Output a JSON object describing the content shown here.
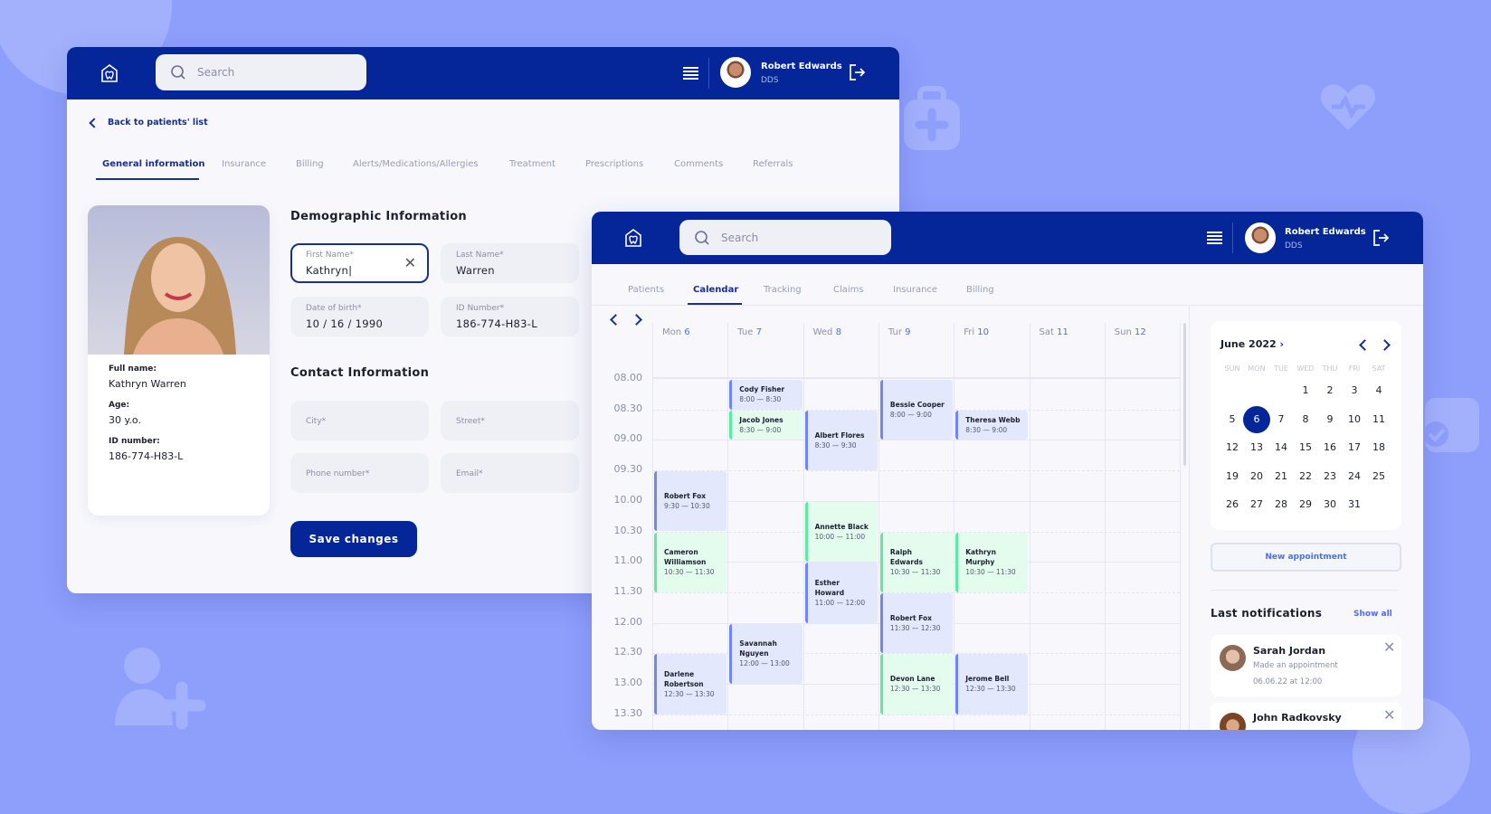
{
  "colors": {
    "background": "#8e9efb",
    "header": "#042698",
    "accent": "#4e6ef2",
    "event_blue": "#e3e8fc",
    "event_green": "#e3fcee"
  },
  "patient_window": {
    "search_placeholder": "Search",
    "user": {
      "name": "Robert Edwards",
      "role": "DDS"
    },
    "back_link": "Back to patients' list",
    "tabs": [
      {
        "label": "General information",
        "active": true
      },
      {
        "label": "Insurance"
      },
      {
        "label": "Billing"
      },
      {
        "label": "Alerts/Medications/Allergies"
      },
      {
        "label": "Treatment"
      },
      {
        "label": "Prescriptions"
      },
      {
        "label": "Comments"
      },
      {
        "label": "Referrals"
      }
    ],
    "profile": {
      "full_name_label": "Full name:",
      "full_name": "Kathryn Warren",
      "age_label": "Age:",
      "age": "30 y.o.",
      "id_label": "ID number:",
      "id": "186-774-H83-L"
    },
    "demographic": {
      "title": "Demographic Information",
      "first_name": {
        "label": "First Name*",
        "value": "Kathryn|"
      },
      "last_name": {
        "label": "Last Name*",
        "value": "Warren"
      },
      "dob": {
        "label": "Date of birth*",
        "value": "10 / 16 / 1990"
      },
      "id_number": {
        "label": "ID Number*",
        "value": "186-774-H83-L"
      }
    },
    "contact": {
      "title": "Contact Information",
      "city": "City*",
      "street": "Street*",
      "phone": "Phone number*",
      "email": "Email*"
    },
    "save_label": "Save changes"
  },
  "calendar_window": {
    "search_placeholder": "Search",
    "user": {
      "name": "Robert Edwards",
      "role": "DDS"
    },
    "tabs": [
      {
        "label": "Patients"
      },
      {
        "label": "Calendar",
        "active": true
      },
      {
        "label": "Tracking"
      },
      {
        "label": "Claims"
      },
      {
        "label": "Insurance"
      },
      {
        "label": "Billing"
      }
    ],
    "days": [
      {
        "name": "Mon",
        "num": "6"
      },
      {
        "name": "Tue",
        "num": "7"
      },
      {
        "name": "Wed",
        "num": "8"
      },
      {
        "name": "Tur",
        "num": "9"
      },
      {
        "name": "Fri",
        "num": "10"
      },
      {
        "name": "Sat",
        "num": "11"
      },
      {
        "name": "Sun",
        "num": "12"
      }
    ],
    "times": [
      "08.00",
      "08.30",
      "09.00",
      "09.30",
      "10.00",
      "10.30",
      "11.00",
      "11.30",
      "12.00",
      "12.30",
      "13.00",
      "13.30"
    ],
    "events": [
      {
        "day": 0,
        "name": "Robert Fox",
        "time": "9:30 — 10:30",
        "start": 9.5,
        "end": 10.5,
        "color": "blue"
      },
      {
        "day": 0,
        "name": "Cameron Williamson",
        "time": "10:30 — 11:30",
        "start": 10.5,
        "end": 11.5,
        "color": "green"
      },
      {
        "day": 0,
        "name": "Darlene Robertson",
        "time": "12:30 — 13:30",
        "start": 12.5,
        "end": 13.5,
        "color": "blue"
      },
      {
        "day": 1,
        "name": "Cody Fisher",
        "time": "8:00 — 8:30",
        "start": 8,
        "end": 8.5,
        "color": "blue"
      },
      {
        "day": 1,
        "name": "Jacob Jones",
        "time": "8:30 — 9:00",
        "start": 8.5,
        "end": 9,
        "color": "green"
      },
      {
        "day": 1,
        "name": "Savannah Nguyen",
        "time": "12:00 — 13:00",
        "start": 12,
        "end": 13,
        "color": "blue"
      },
      {
        "day": 2,
        "name": "Albert Flores",
        "time": "8:30 — 9:30",
        "start": 8.5,
        "end": 9.5,
        "color": "blue"
      },
      {
        "day": 2,
        "name": "Annette Black",
        "time": "10:00 — 11:00",
        "start": 10,
        "end": 11,
        "color": "green"
      },
      {
        "day": 2,
        "name": "Esther Howard",
        "time": "11:00 — 12:00",
        "start": 11,
        "end": 12,
        "color": "blue"
      },
      {
        "day": 3,
        "name": "Bessie Cooper",
        "time": "8:00 — 9:00",
        "start": 8,
        "end": 9,
        "color": "blue"
      },
      {
        "day": 3,
        "name": "Ralph Edwards",
        "time": "10:30 — 11:30",
        "start": 10.5,
        "end": 11.5,
        "color": "green"
      },
      {
        "day": 3,
        "name": "Robert Fox",
        "time": "11:30 — 12:30",
        "start": 11.5,
        "end": 12.5,
        "color": "blue"
      },
      {
        "day": 3,
        "name": "Devon Lane",
        "time": "12:30 — 13:30",
        "start": 12.5,
        "end": 13.5,
        "color": "green"
      },
      {
        "day": 4,
        "name": "Theresa Webb",
        "time": "8:30 — 9:00",
        "start": 8.5,
        "end": 9,
        "color": "blue"
      },
      {
        "day": 4,
        "name": "Kathryn Murphy",
        "time": "10:30 — 11:30",
        "start": 10.5,
        "end": 11.5,
        "color": "green"
      },
      {
        "day": 4,
        "name": "Jerome Bell",
        "time": "12:30 — 13:30",
        "start": 12.5,
        "end": 13.5,
        "color": "blue"
      }
    ],
    "mini_calendar": {
      "month": "June 2022",
      "weekdays": [
        "SUN",
        "MON",
        "TUE",
        "WED",
        "THU",
        "FRI",
        "SAT"
      ],
      "first_weekday": 3,
      "days_in_month": 31,
      "selected": 6
    },
    "new_appointment": "New appointment",
    "notifications_title": "Last notifications",
    "show_all": "Show all",
    "notifications": [
      {
        "name": "Sarah Jordan",
        "text": "Made an appointment",
        "date": "06.06.22 at 12:00"
      },
      {
        "name": "John Radkovsky"
      }
    ]
  }
}
